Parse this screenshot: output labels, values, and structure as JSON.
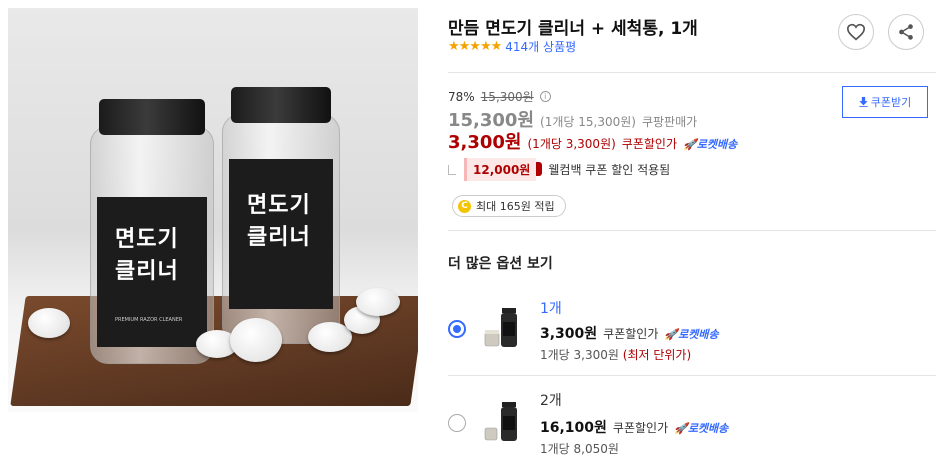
{
  "product": {
    "title": "만듬 면도기 클리너 + 세척통, 1개",
    "stars": "★★★★★",
    "review_count": "414개 상품평",
    "image": {
      "label_line1": "면도기",
      "label_line2": "클리너",
      "label_small": "PREMIUM RAZOR CLEANER"
    }
  },
  "pricing": {
    "discount_rate": "78%",
    "original_price": "15,300원",
    "info_icon": "i",
    "sale_price": "15,300원",
    "sale_unit": "(1개당 15,300원)",
    "sale_label": "쿠팡판매가",
    "coupon_price": "3,300원",
    "coupon_unit": "(1개당 3,300원)",
    "coupon_label": "쿠폰할인가",
    "rocket_label": "로켓배송",
    "welcome_amount": "12,000원",
    "welcome_text": "웰컴백 쿠폰 할인 적용됨",
    "cash_icon": "C",
    "cash_text": "최대 165원 적립",
    "coupon_button": "쿠폰받기"
  },
  "options": {
    "heading": "더 많은 옵션 보기",
    "items": [
      {
        "name": "1개",
        "price": "3,300원",
        "price_label": "쿠폰할인가",
        "rocket": "로켓배송",
        "unit": "1개당 3,300원",
        "lowest": "(최저 단위가)",
        "selected": true
      },
      {
        "name": "2개",
        "price": "16,100원",
        "price_label": "쿠폰할인가",
        "rocket": "로켓배송",
        "unit": "1개당 8,050원",
        "lowest": "",
        "selected": false
      }
    ]
  },
  "icons": {
    "heart": "heart-icon",
    "share": "share-icon",
    "rocket": "rocket-icon",
    "download": "download-icon"
  },
  "colors": {
    "accent": "#346aff",
    "coupon_red": "#ae0000",
    "star": "#f2a300"
  }
}
